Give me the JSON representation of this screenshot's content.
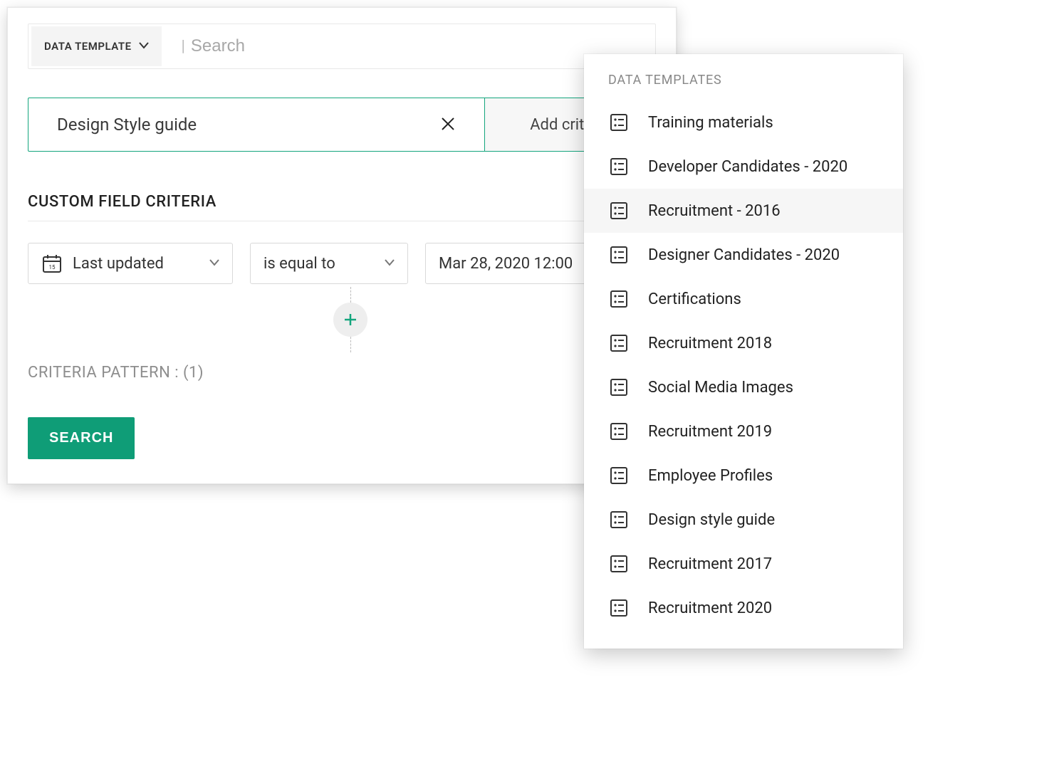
{
  "topbar": {
    "chip_label": "DATA TEMPLATE",
    "search_placeholder": "Search"
  },
  "criteria_input": {
    "value": "Design Style guide",
    "add_label": "Add criteria"
  },
  "section": {
    "custom_field_header": "CUSTOM FIELD CRITERIA",
    "criteria_pattern": "CRITERIA PATTERN : (1)"
  },
  "filter": {
    "field": "Last updated",
    "operator": "is equal to",
    "value": "Mar 28, 2020 12:00"
  },
  "actions": {
    "search": "SEARCH"
  },
  "dropdown": {
    "header": "DATA TEMPLATES",
    "items": [
      {
        "label": "Training materials",
        "highlighted": false
      },
      {
        "label": "Developer Candidates - 2020",
        "highlighted": false
      },
      {
        "label": "Recruitment - 2016",
        "highlighted": true
      },
      {
        "label": "Designer Candidates - 2020",
        "highlighted": false
      },
      {
        "label": "Certifications",
        "highlighted": false
      },
      {
        "label": "Recruitment 2018",
        "highlighted": false
      },
      {
        "label": "Social Media Images",
        "highlighted": false
      },
      {
        "label": "Recruitment 2019",
        "highlighted": false
      },
      {
        "label": "Employee Profiles",
        "highlighted": false
      },
      {
        "label": "Design style guide",
        "highlighted": false
      },
      {
        "label": "Recruitment 2017",
        "highlighted": false
      },
      {
        "label": "Recruitment 2020",
        "highlighted": false
      }
    ]
  }
}
